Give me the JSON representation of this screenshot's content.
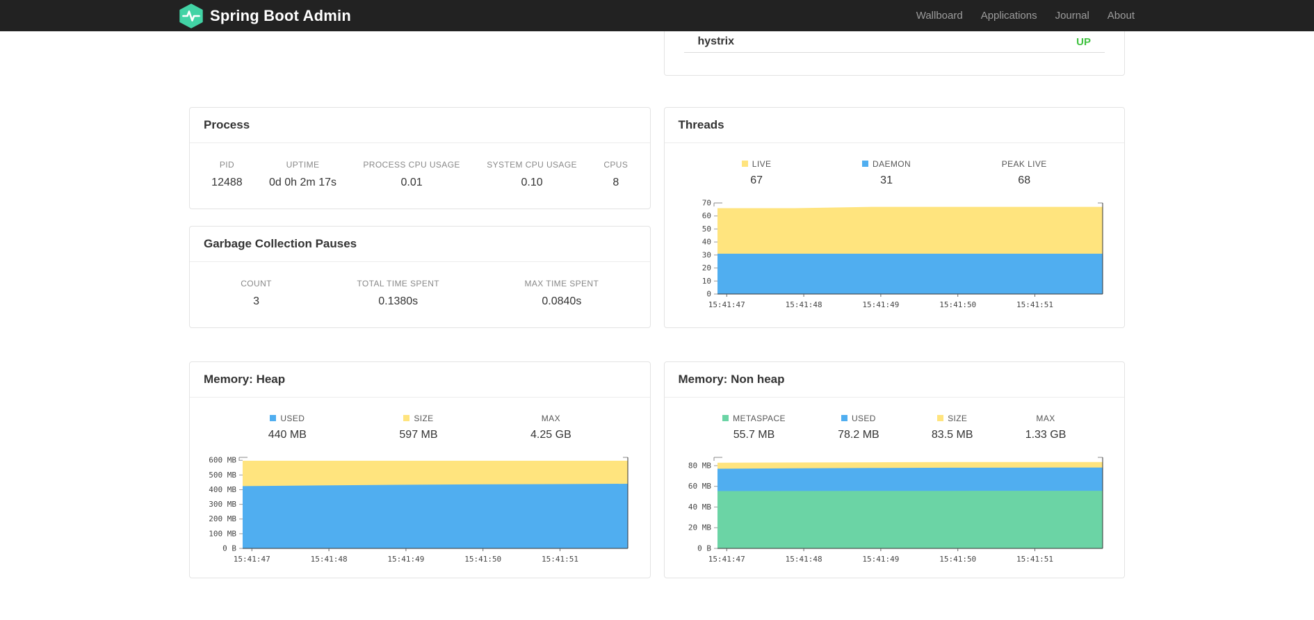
{
  "navbar": {
    "brand": "Spring Boot Admin",
    "links": [
      {
        "label": "Wallboard"
      },
      {
        "label": "Applications"
      },
      {
        "label": "Journal"
      },
      {
        "label": "About"
      }
    ]
  },
  "applications": {
    "rows": [
      {
        "name": "hystrix",
        "status": "UP"
      }
    ]
  },
  "process": {
    "title": "Process",
    "metrics": [
      {
        "label": "PID",
        "value": "12488"
      },
      {
        "label": "UPTIME",
        "value": "0d 0h 2m 17s"
      },
      {
        "label": "PROCESS CPU USAGE",
        "value": "0.01"
      },
      {
        "label": "SYSTEM CPU USAGE",
        "value": "0.10"
      },
      {
        "label": "CPUS",
        "value": "8"
      }
    ]
  },
  "gc": {
    "title": "Garbage Collection Pauses",
    "metrics": [
      {
        "label": "COUNT",
        "value": "3"
      },
      {
        "label": "TOTAL TIME SPENT",
        "value": "0.1380s"
      },
      {
        "label": "MAX TIME SPENT",
        "value": "0.0840s"
      }
    ]
  },
  "threads": {
    "title": "Threads",
    "legend": [
      {
        "label": "LIVE",
        "value": "67",
        "swatch": "#ffe47e"
      },
      {
        "label": "DAEMON",
        "value": "31",
        "swatch": "#50aef0"
      },
      {
        "label": "PEAK LIVE",
        "value": "68"
      }
    ]
  },
  "heap": {
    "title": "Memory: Heap",
    "legend": [
      {
        "label": "USED",
        "value": "440 MB",
        "swatch": "#50aef0"
      },
      {
        "label": "SIZE",
        "value": "597 MB",
        "swatch": "#ffe47e"
      },
      {
        "label": "MAX",
        "value": "4.25 GB"
      }
    ]
  },
  "nonheap": {
    "title": "Memory: Non heap",
    "legend": [
      {
        "label": "METASPACE",
        "value": "55.7 MB",
        "swatch": "#6bd4a5"
      },
      {
        "label": "USED",
        "value": "78.2 MB",
        "swatch": "#50aef0"
      },
      {
        "label": "SIZE",
        "value": "83.5 MB",
        "swatch": "#ffe47e"
      },
      {
        "label": "MAX",
        "value": "1.33 GB"
      }
    ]
  },
  "colors": {
    "status_up": "#3fc13f",
    "brand_green": "#42d3a5",
    "area_blue": "#50aef0",
    "area_yellow": "#ffe47e",
    "area_green": "#6bd4a5"
  },
  "chart_data": [
    {
      "id": "threads",
      "type": "area",
      "title": "Threads",
      "x_labels": [
        "15:41:47",
        "15:41:48",
        "15:41:49",
        "15:41:50",
        "15:41:51"
      ],
      "ylim": [
        0,
        70
      ],
      "yticks": [
        {
          "v": 0,
          "label": "0"
        },
        {
          "v": 10,
          "label": "10"
        },
        {
          "v": 20,
          "label": "20"
        },
        {
          "v": 30,
          "label": "30"
        },
        {
          "v": 40,
          "label": "40"
        },
        {
          "v": 50,
          "label": "50"
        },
        {
          "v": 60,
          "label": "60"
        },
        {
          "v": 70,
          "label": "70"
        }
      ],
      "grid": false,
      "legend_position": "top",
      "series": [
        {
          "name": "LIVE",
          "color": "#ffe47e",
          "values": [
            66,
            66,
            67,
            67,
            67,
            67
          ]
        },
        {
          "name": "DAEMON",
          "color": "#50aef0",
          "values": [
            31,
            31,
            31,
            31,
            31,
            31
          ]
        }
      ]
    },
    {
      "id": "memory-heap",
      "type": "area",
      "title": "Memory: Heap",
      "x_labels": [
        "15:41:47",
        "15:41:48",
        "15:41:49",
        "15:41:50",
        "15:41:51"
      ],
      "ylim": [
        0,
        620
      ],
      "yticks": [
        {
          "v": 0,
          "label": "0 B"
        },
        {
          "v": 100,
          "label": "100 MB"
        },
        {
          "v": 200,
          "label": "200 MB"
        },
        {
          "v": 300,
          "label": "300 MB"
        },
        {
          "v": 400,
          "label": "400 MB"
        },
        {
          "v": 500,
          "label": "500 MB"
        },
        {
          "v": 600,
          "label": "600 MB"
        }
      ],
      "grid": false,
      "legend_position": "top",
      "series": [
        {
          "name": "SIZE",
          "color": "#ffe47e",
          "values": [
            597,
            597,
            597,
            597,
            597,
            597
          ]
        },
        {
          "name": "USED",
          "color": "#50aef0",
          "values": [
            424,
            429,
            433,
            436,
            438,
            440
          ]
        }
      ]
    },
    {
      "id": "memory-nonheap",
      "type": "area",
      "title": "Memory: Non heap",
      "x_labels": [
        "15:41:47",
        "15:41:48",
        "15:41:49",
        "15:41:50",
        "15:41:51"
      ],
      "ylim": [
        0,
        88
      ],
      "yticks": [
        {
          "v": 0,
          "label": "0 B"
        },
        {
          "v": 20,
          "label": "20 MB"
        },
        {
          "v": 40,
          "label": "40 MB"
        },
        {
          "v": 60,
          "label": "60 MB"
        },
        {
          "v": 80,
          "label": "80 MB"
        }
      ],
      "grid": false,
      "legend_position": "top",
      "series": [
        {
          "name": "SIZE",
          "color": "#ffe47e",
          "values": [
            82.8,
            83.0,
            83.2,
            83.5,
            83.5,
            83.5
          ]
        },
        {
          "name": "USED",
          "color": "#50aef0",
          "values": [
            77.0,
            77.4,
            77.7,
            78.0,
            78.1,
            78.2
          ]
        },
        {
          "name": "METASPACE",
          "color": "#6bd4a5",
          "values": [
            55.4,
            55.5,
            55.6,
            55.6,
            55.7,
            55.7
          ]
        }
      ]
    }
  ]
}
